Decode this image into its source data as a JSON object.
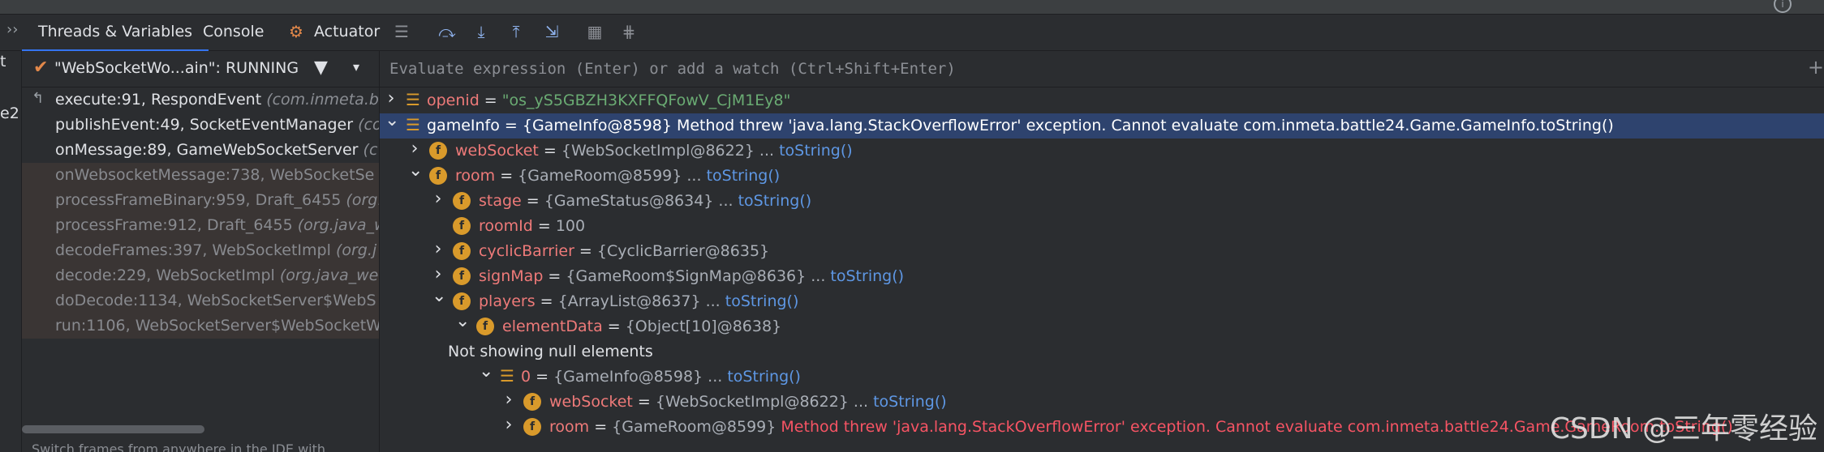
{
  "tabs": {
    "threads": "Threads & Variables",
    "console": "Console",
    "actuator": "Actuator"
  },
  "left_strip": [
    "t",
    "e2"
  ],
  "thread": {
    "name": "\"WebSocketWo...ain\": RUNNING"
  },
  "frames": [
    {
      "loc": "execute:91, RespondEvent ",
      "pkg": "(com.inmeta.ba",
      "lib": false,
      "current": true
    },
    {
      "loc": "publishEvent:49, SocketEventManager ",
      "pkg": "(co",
      "lib": false,
      "current": false
    },
    {
      "loc": "onMessage:89, GameWebSocketServer ",
      "pkg": "(c",
      "lib": false,
      "current": false
    },
    {
      "loc": "onWebsocketMessage:738, WebSocketSe",
      "pkg": "",
      "lib": true,
      "current": false
    },
    {
      "loc": "processFrameBinary:959, Draft_6455 ",
      "pkg": "(org.",
      "lib": true,
      "current": false
    },
    {
      "loc": "processFrame:912, Draft_6455 ",
      "pkg": "(org.java_w",
      "lib": true,
      "current": false
    },
    {
      "loc": "decodeFrames:397, WebSocketImpl ",
      "pkg": "(org.j",
      "lib": true,
      "current": false
    },
    {
      "loc": "decode:229, WebSocketImpl ",
      "pkg": "(org.java_we",
      "lib": true,
      "current": false
    },
    {
      "loc": "doDecode:1134, WebSocketServer$WebS",
      "pkg": "",
      "lib": true,
      "current": false
    },
    {
      "loc": "run:1106, WebSocketServer$WebSocketW",
      "pkg": "",
      "lib": true,
      "current": false
    }
  ],
  "hint": "Switch frames from anywhere in the IDE with",
  "watch_placeholder": "Evaluate expression (Enter) or add a watch (Ctrl+Shift+Enter)",
  "variables": [
    {
      "key": "openid",
      "eq": " = ",
      "val": "",
      "str": "\"os_yS5GBZH3KXFFQFowV_CjM1Ey8\"",
      "link": "",
      "err": ""
    },
    {
      "key": "gameInfo",
      "eq": " = ",
      "val": "{GameInfo@8598} Method threw 'java.lang.StackOverflowError' exception. Cannot evaluate com.inmeta.battle24.Game.GameInfo.toString()",
      "str": "",
      "link": "",
      "err": ""
    },
    {
      "key": "webSocket",
      "eq": " = ",
      "val": "{WebSocketImpl@8622} ... ",
      "str": "",
      "link": "toString()",
      "err": ""
    },
    {
      "key": "room",
      "eq": " = ",
      "val": "{GameRoom@8599} ... ",
      "str": "",
      "link": "toString()",
      "err": ""
    },
    {
      "key": "stage",
      "eq": " = ",
      "val": "{GameStatus@8634} ... ",
      "str": "",
      "link": "toString()",
      "err": ""
    },
    {
      "key": "roomId",
      "eq": " = ",
      "val": "100",
      "str": "",
      "link": "",
      "err": ""
    },
    {
      "key": "cyclicBarrier",
      "eq": " = ",
      "val": "{CyclicBarrier@8635}",
      "str": "",
      "link": "",
      "err": ""
    },
    {
      "key": "signMap",
      "eq": " = ",
      "val": "{GameRoom$SignMap@8636} ... ",
      "str": "",
      "link": "toString()",
      "err": ""
    },
    {
      "key": "players",
      "eq": " = ",
      "val": "{ArrayList@8637} ... ",
      "str": "",
      "link": "toString()",
      "err": ""
    },
    {
      "key": "elementData",
      "eq": " = ",
      "val": "{Object[10]@8638}",
      "str": "",
      "link": "",
      "err": ""
    },
    {
      "key": "",
      "eq": "",
      "val": "Not showing null elements",
      "str": "",
      "link": "",
      "err": ""
    },
    {
      "key": "0",
      "eq": " = ",
      "val": "{GameInfo@8598} ... ",
      "str": "",
      "link": "toString()",
      "err": ""
    },
    {
      "key": "webSocket",
      "eq": " = ",
      "val": "{WebSocketImpl@8622} ... ",
      "str": "",
      "link": "toString()",
      "err": ""
    },
    {
      "key": "room",
      "eq": " = ",
      "val": "{GameRoom@8599} ",
      "str": "",
      "link": "",
      "err": "Method threw 'java.lang.StackOverflowError' exception. Cannot evaluate com.inmeta.battle24.Game.GameRoom.toString()"
    }
  ],
  "watermark": "CSDN @三年零经验"
}
